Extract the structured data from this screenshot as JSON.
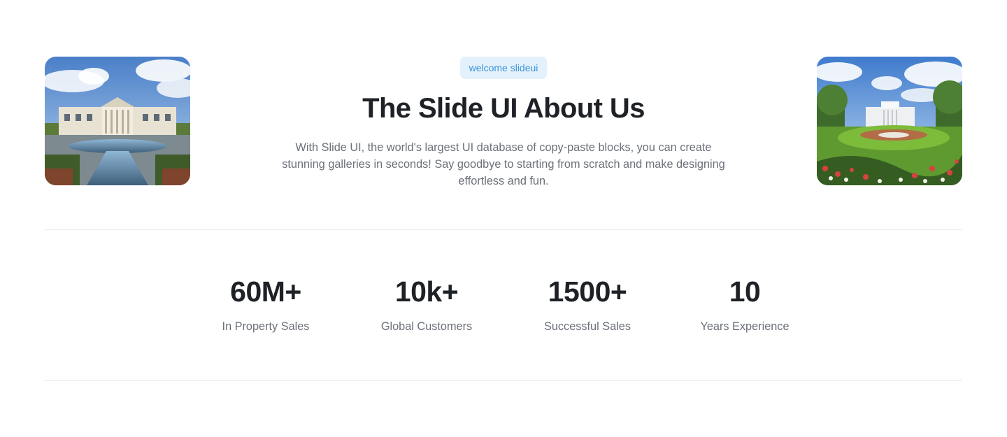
{
  "hero": {
    "badge": "welcome slideui",
    "title": "The Slide UI About Us",
    "description": "With Slide UI, the world's largest UI database of copy-paste blocks, you can create stunning galleries in seconds! Say goodbye to starting from scratch and make designing effortless and fun."
  },
  "images": {
    "left": {
      "alt": "Neoclassical mansion with reflecting pool"
    },
    "right": {
      "alt": "White house with flower garden and lawn"
    }
  },
  "stats": [
    {
      "value": "60M+",
      "label": "In Property Sales"
    },
    {
      "value": "10k+",
      "label": "Global Customers"
    },
    {
      "value": "1500+",
      "label": "Successful Sales"
    },
    {
      "value": "10",
      "label": "Years Experience"
    }
  ],
  "colors": {
    "badge_bg": "#e3f1fc",
    "badge_text": "#3b93d6",
    "heading": "#1e2227",
    "body_text": "#6b7079",
    "divider": "#ececee"
  }
}
